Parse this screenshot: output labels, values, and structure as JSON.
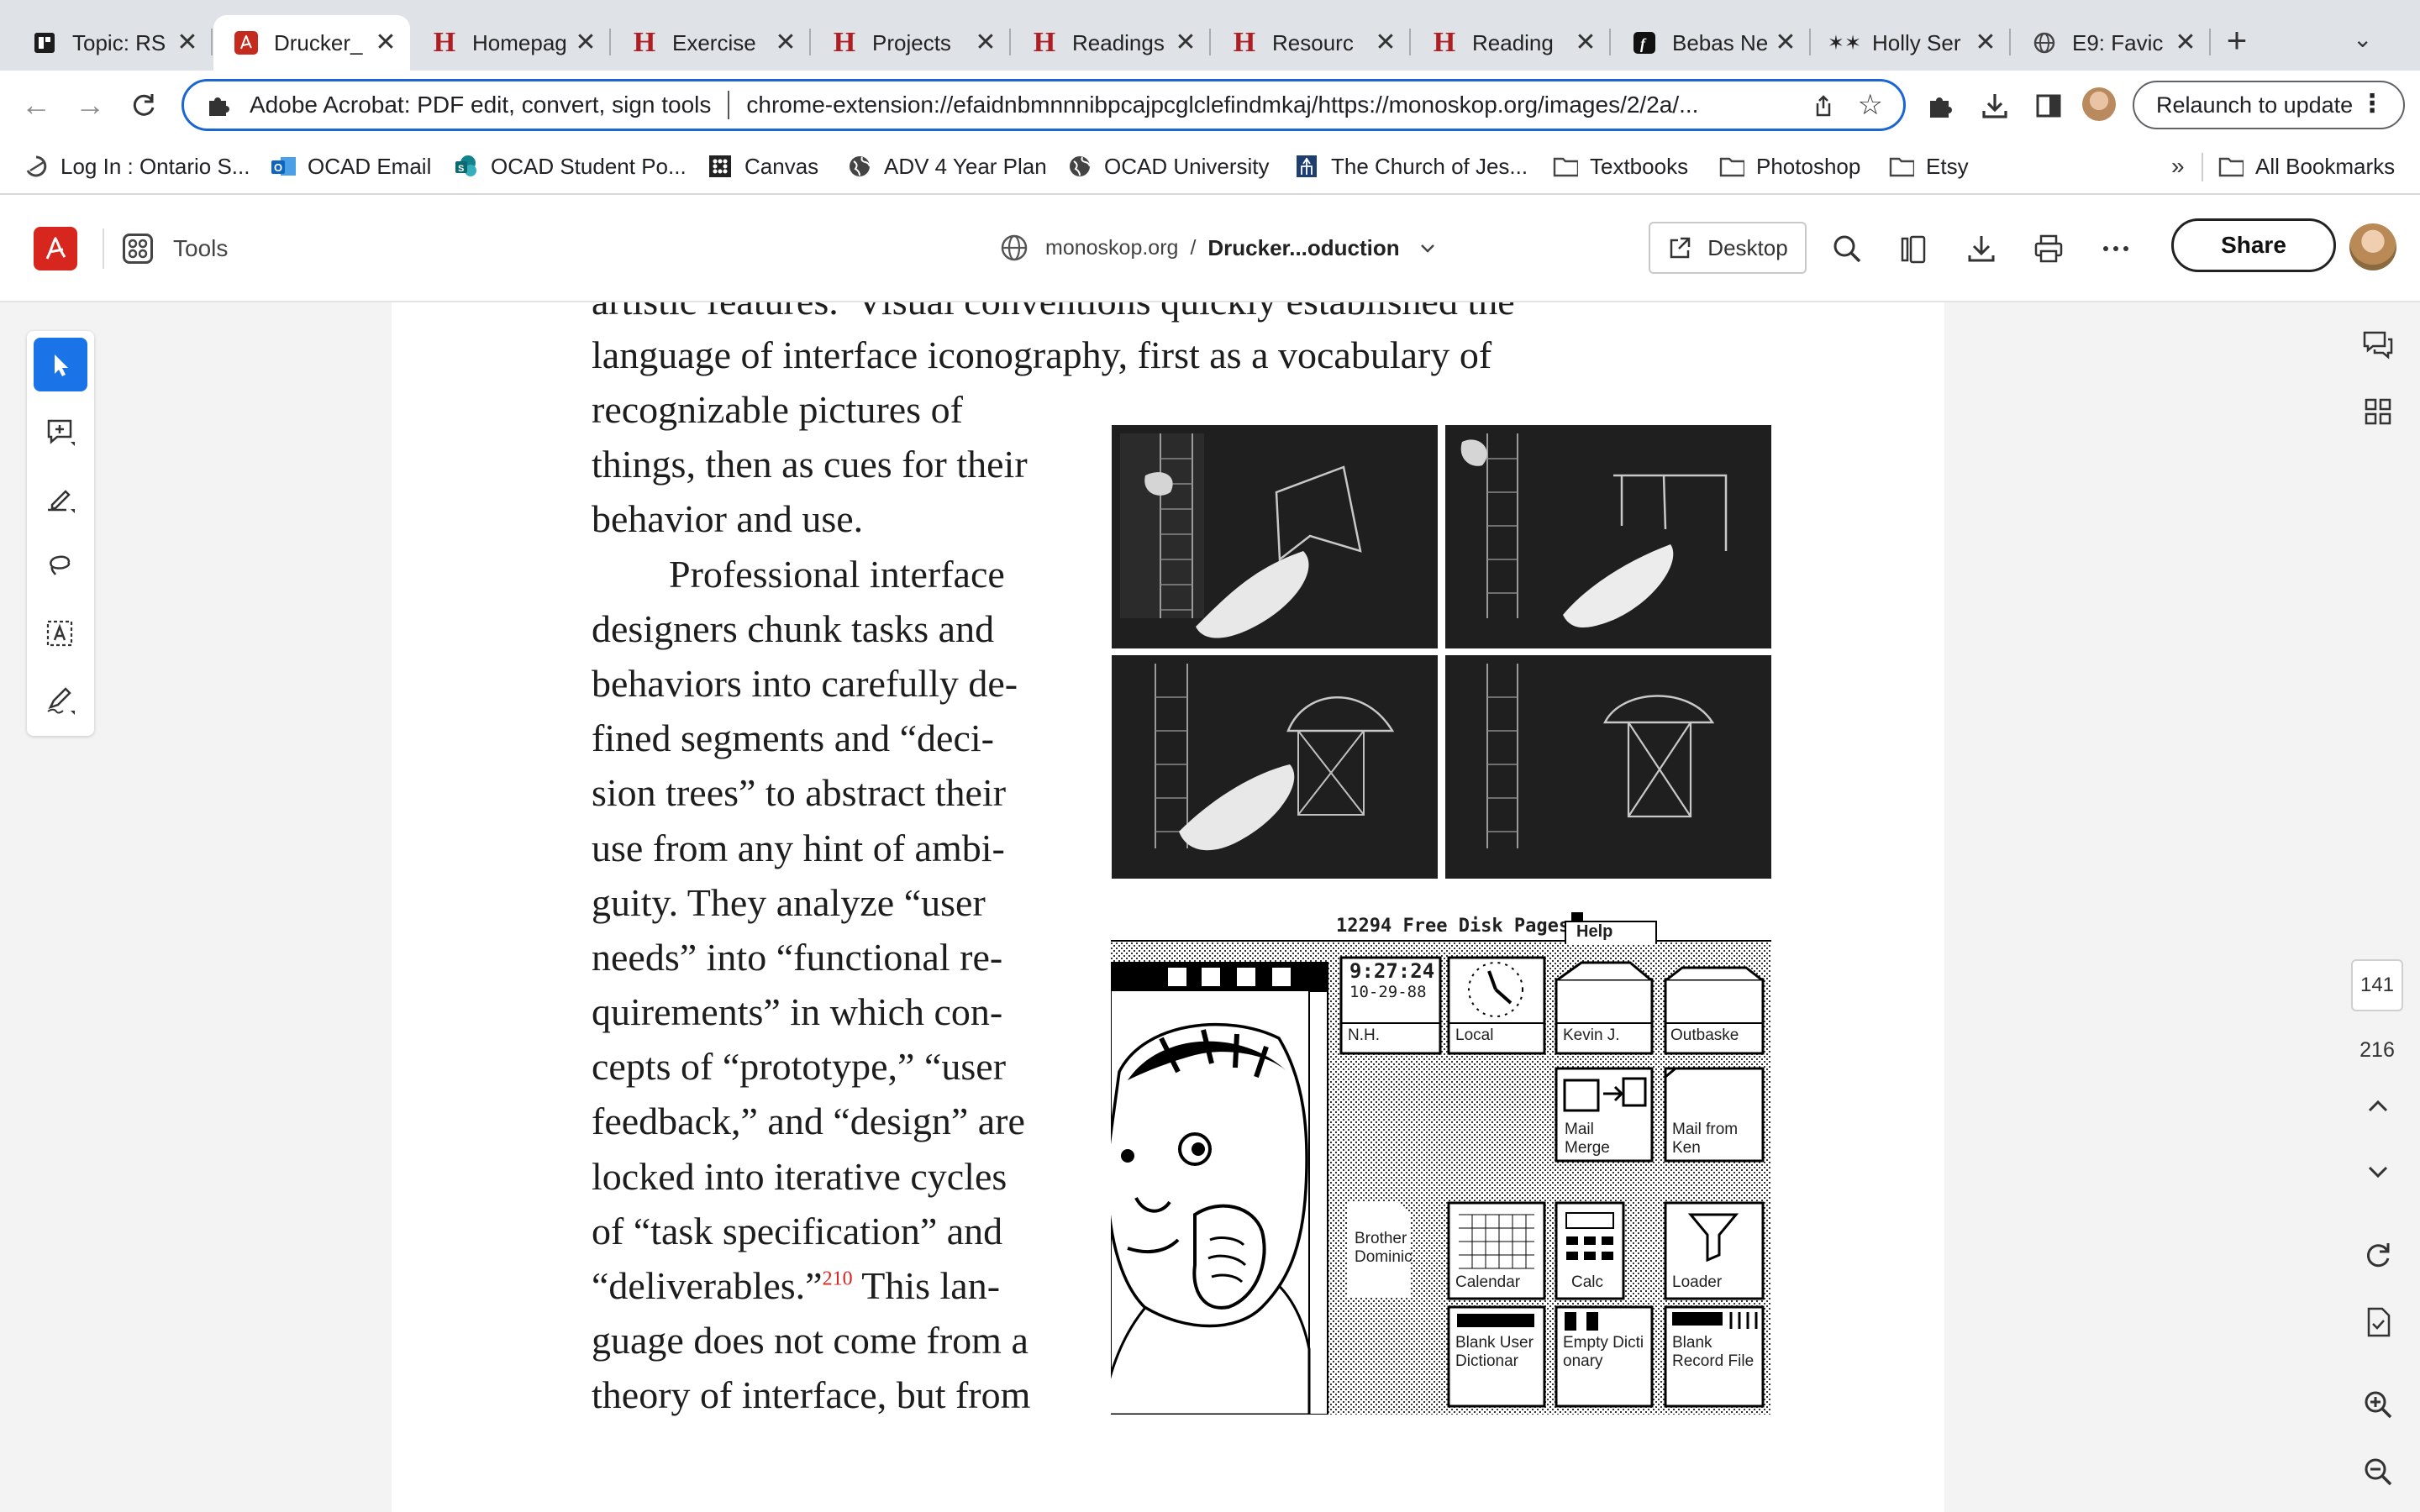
{
  "browser": {
    "tabs": [
      {
        "title": "Topic: RS",
        "icon": "dark-square-icon"
      },
      {
        "title": "Drucker_",
        "icon": "acrobat-icon",
        "active": true
      },
      {
        "title": "Homepag",
        "icon": "h-logo-icon"
      },
      {
        "title": "Exercise",
        "icon": "h-logo-icon"
      },
      {
        "title": "Projects",
        "icon": "h-logo-icon"
      },
      {
        "title": "Readings",
        "icon": "h-logo-icon"
      },
      {
        "title": "Resourc",
        "icon": "h-logo-icon"
      },
      {
        "title": "Reading",
        "icon": "h-logo-icon"
      },
      {
        "title": "Bebas Ne",
        "icon": "font-f-icon"
      },
      {
        "title": "Holly Ser",
        "icon": "stars-icon"
      },
      {
        "title": "E9: Favic",
        "icon": "globe-icon"
      }
    ],
    "close_glyph": "✕",
    "new_tab_glyph": "+",
    "tab_menu_glyph": "⌄",
    "omnibox": {
      "site_name": "Adobe Acrobat: PDF edit, convert, sign tools",
      "url": "chrome-extension://efaidnbmnnnibpcajpcglclefindmkaj/https://monoskop.org/images/2/2a/..."
    },
    "relaunch_label": "Relaunch to update",
    "bookmarks": [
      {
        "label": "Log In : Ontario S...",
        "icon": "swirl-icon"
      },
      {
        "label": "OCAD Email",
        "icon": "outlook-icon"
      },
      {
        "label": "OCAD Student Po...",
        "icon": "sharepoint-icon"
      },
      {
        "label": "Canvas",
        "icon": "canvas-icon"
      },
      {
        "label": "ADV 4 Year Plan",
        "icon": "globe-icon"
      },
      {
        "label": "OCAD University",
        "icon": "globe-icon"
      },
      {
        "label": "The Church of Jes...",
        "icon": "church-icon"
      },
      {
        "label": "Textbooks",
        "icon": "folder-icon"
      },
      {
        "label": "Photoshop",
        "icon": "folder-icon"
      },
      {
        "label": "Etsy",
        "icon": "folder-icon"
      }
    ],
    "bookmarks_overflow": "»",
    "all_bookmarks_label": "All Bookmarks"
  },
  "acrobat": {
    "tools_label": "Tools",
    "breadcrumb_site": "monoskop.org",
    "breadcrumb_sep": "/",
    "document_name": "Drucker...oduction",
    "desktop_label": "Desktop",
    "share_label": "Share",
    "current_page": "141",
    "total_pages": "216"
  },
  "document": {
    "full_lines": [
      "artistic features.  Visual conventions quickly established the",
      "language of interface iconography, first as a vocabulary of"
    ],
    "column_lines": [
      "recognizable pictures of",
      "things, then as cues for their",
      "behavior and use.",
      "  Professional interface",
      "designers chunk tasks and",
      "behaviors into carefully de-",
      "fined segments and “deci-",
      "sion trees” to abstract their",
      "use from any hint of ambi-",
      "guity. They analyze “user",
      "needs” into “functional re-",
      "quirements” in which con-",
      "cepts of “prototype,” “user",
      "feedback,” and “design” are",
      "locked into iterative cycles",
      "of “task specification” and"
    ],
    "footnote_line_before": "“deliverables.”",
    "footnote_number": "210",
    "footnote_line_after": " This lan-",
    "tail_lines": [
      "guage does not come from a",
      "theory of interface, but from"
    ],
    "figure_mac": {
      "menubar_text": "12294 Free Disk Pages",
      "help_label": "Help",
      "clock_time": "9:27:24",
      "clock_date": "10-29-88",
      "icons": [
        "N.H.",
        "Local",
        "Kevin J.",
        "Outbaske",
        "Mail Merge",
        "Mail from Ken",
        "Brother Dominic",
        "Calendar",
        "Calc",
        "Loader",
        "Blank User Dictionar",
        "Empty Dictionary",
        "Blank Record File"
      ]
    }
  }
}
